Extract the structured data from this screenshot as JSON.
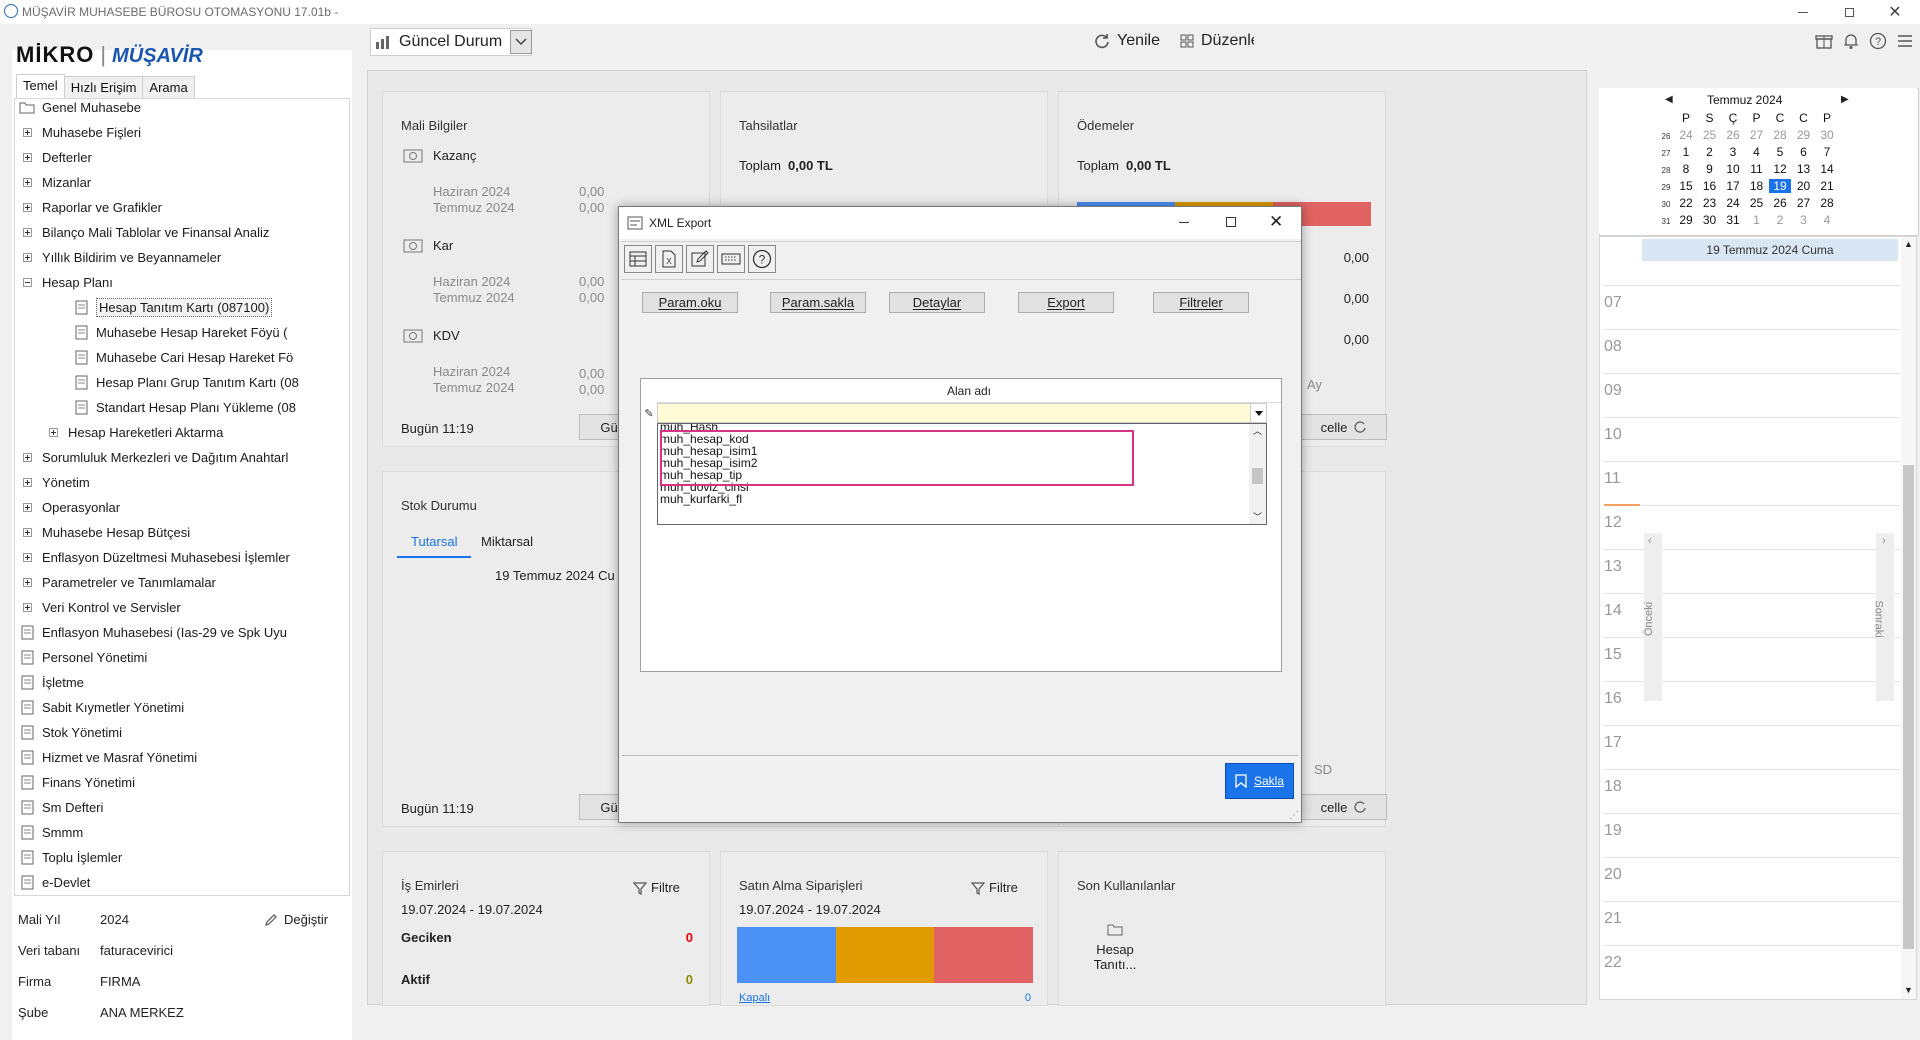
{
  "window": {
    "title": "MÜŞAVİR MUHASEBE BÜROSU OTOMASYONU 17.01b -"
  },
  "logo": {
    "brand": "MİKRO",
    "product": "MÜŞAVİR"
  },
  "left_tabs": [
    "Temel",
    "Hızlı Erişim",
    "Arama"
  ],
  "tree": [
    {
      "label": "Genel Muhasebe",
      "icon": "folder-open-icon"
    },
    {
      "label": "Muhasebe Fişleri",
      "icon": "expand-plus-icon"
    },
    {
      "label": "Defterler",
      "icon": "expand-plus-icon"
    },
    {
      "label": "Mizanlar",
      "icon": "expand-plus-icon"
    },
    {
      "label": "Raporlar ve Grafikler",
      "icon": "expand-plus-icon"
    },
    {
      "label": "Bilanço Mali Tablolar ve Finansal Analiz",
      "icon": "expand-plus-icon"
    },
    {
      "label": "Yıllık Bildirim ve Beyannameler",
      "icon": "expand-plus-icon"
    },
    {
      "label": "Hesap Planı",
      "icon": "collapse-minus-icon"
    },
    {
      "label": "Hesap Tanıtım Kartı (087100)",
      "icon": "form-icon",
      "selected": true
    },
    {
      "label": "Muhasebe Hesap Hareket Föyü (",
      "icon": "report-icon"
    },
    {
      "label": "Muhasebe Cari Hesap Hareket Fö",
      "icon": "report-icon"
    },
    {
      "label": "Hesap Planı Grup Tanıtım Kartı (08",
      "icon": "form-icon"
    },
    {
      "label": "Standart Hesap Planı Yükleme (08",
      "icon": "form-icon"
    },
    {
      "label": "Hesap Hareketleri Aktarma",
      "icon": "expand-plus-icon"
    },
    {
      "label": "Sorumluluk Merkezleri ve Dağıtım Anahtarl",
      "icon": "expand-plus-icon"
    },
    {
      "label": "Yönetim",
      "icon": "expand-plus-icon"
    },
    {
      "label": "Operasyonlar",
      "icon": "expand-plus-icon"
    },
    {
      "label": "Muhasebe Hesap Bütçesi",
      "icon": "expand-plus-icon"
    },
    {
      "label": "Enflasyon Düzeltmesi Muhasebesi İşlemler",
      "icon": "expand-plus-icon"
    },
    {
      "label": "Parametreler ve Tanımlamalar",
      "icon": "expand-plus-icon"
    },
    {
      "label": "Veri Kontrol ve Servisler",
      "icon": "expand-plus-icon"
    },
    {
      "label": "Enflasyon Muhasebesi (Ias-29 ve Spk Uyu",
      "icon": "trend-icon"
    },
    {
      "label": "Personel Yönetimi",
      "icon": "people-icon"
    },
    {
      "label": "İşletme",
      "icon": "basket-icon"
    },
    {
      "label": "Sabit Kıymetler Yönetimi",
      "icon": "document-icon"
    },
    {
      "label": "Stok Yönetimi",
      "icon": "boxes-icon"
    },
    {
      "label": "Hizmet ve Masraf Yönetimi",
      "icon": "list-icon"
    },
    {
      "label": "Finans Yönetimi",
      "icon": "ledger-icon"
    },
    {
      "label": "Sm Defteri",
      "icon": "chat-icon"
    },
    {
      "label": "Smmm",
      "icon": "stack-icon"
    },
    {
      "label": "Toplu İşlemler",
      "icon": "user-icon"
    },
    {
      "label": "e-Devlet",
      "icon": "calendar-doc-icon"
    }
  ],
  "info": {
    "mali_yil_label": "Mali Yıl",
    "mali_yil": "2024",
    "change": "Değiştir",
    "db_label": "Veri tabanı",
    "db": "faturacevirici",
    "firma_label": "Firma",
    "firma": "FIRMA",
    "sube_label": "Şube",
    "sube": "ANA MERKEZ"
  },
  "top": {
    "view": "Güncel Durum",
    "refresh": "Yenile",
    "edit": "Düzenle"
  },
  "mali": {
    "title": "Mali Bilgiler",
    "kazanc": "Kazanç",
    "kar": "Kar",
    "kdv": "KDV",
    "m1": "Haziran 2024",
    "m2": "Temmuz 2024",
    "v": "0,00",
    "today": "Bugün 11:19",
    "btn": "Gü"
  },
  "tahsil": {
    "title": "Tahsilatlar",
    "total_label": "Toplam",
    "total": "0,00 TL"
  },
  "odeme": {
    "title": "Ödemeler",
    "total_label": "Toplam",
    "total": "0,00 TL",
    "v": "0,00",
    "side": "Ay",
    "btn": "celle",
    "sd": "SD"
  },
  "stok": {
    "title": "Stok Durumu",
    "tab1": "Tutarsal",
    "tab2": "Miktarsal",
    "date": "19 Temmuz 2024 Cu",
    "today": "Bugün 11:19",
    "btn": "Gü"
  },
  "isemir": {
    "title": "İş Emirleri",
    "range": "19.07.2024 - 19.07.2024",
    "filter": "Filtre",
    "geciken": "Geciken",
    "gv": "0",
    "aktif": "Aktif",
    "av": "0"
  },
  "satin": {
    "title": "Satın Alma Siparişleri",
    "range": "19.07.2024 - 19.07.2024",
    "filter": "Filtre",
    "more": "Kapalı",
    "mv": "0"
  },
  "son": {
    "title": "Son Kullanılanlar",
    "item": "Hesap Tanıtı..."
  },
  "dialog": {
    "title": "XML Export",
    "buttons": [
      "Param.oku",
      "Param.sakla",
      "Detaylar",
      "Export",
      "Filtreler"
    ],
    "column": "Alan adı",
    "items": [
      "muh_Hash",
      "muh_hesap_kod",
      "muh_hesap_isim1",
      "muh_hesap_isim2",
      "muh_hesap_tip",
      "muh_doviz_cinsi",
      "muh_kurfarki_fl"
    ],
    "save": "Sakla"
  },
  "calendar": {
    "month": "Temmuz 2024",
    "days": [
      "P",
      "S",
      "Ç",
      "P",
      "C",
      "C",
      "P"
    ],
    "weeks": [
      "26",
      "27",
      "28",
      "29",
      "30",
      "31"
    ],
    "rows": [
      [
        "24",
        "25",
        "26",
        "27",
        "28",
        "29",
        "30"
      ],
      [
        "1",
        "2",
        "3",
        "4",
        "5",
        "6",
        "7"
      ],
      [
        "8",
        "9",
        "10",
        "11",
        "12",
        "13",
        "14"
      ],
      [
        "15",
        "16",
        "17",
        "18",
        "19",
        "20",
        "21"
      ],
      [
        "22",
        "23",
        "24",
        "25",
        "26",
        "27",
        "28"
      ],
      [
        "29",
        "30",
        "31",
        "1",
        "2",
        "3",
        "4"
      ]
    ],
    "today": "19",
    "header": "19 Temmuz 2024 Cuma",
    "hours": [
      "07",
      "08",
      "09",
      "10",
      "11",
      "12",
      "13",
      "14",
      "15",
      "16",
      "17",
      "18",
      "19",
      "20",
      "21",
      "22"
    ],
    "prev": "Önceki",
    "next": "Sonraki"
  },
  "colors": {
    "blue": "#4a90f5",
    "orange": "#e09b00",
    "red": "#e06262",
    "accent": "#1a73e8",
    "highlight": "#d63384"
  }
}
